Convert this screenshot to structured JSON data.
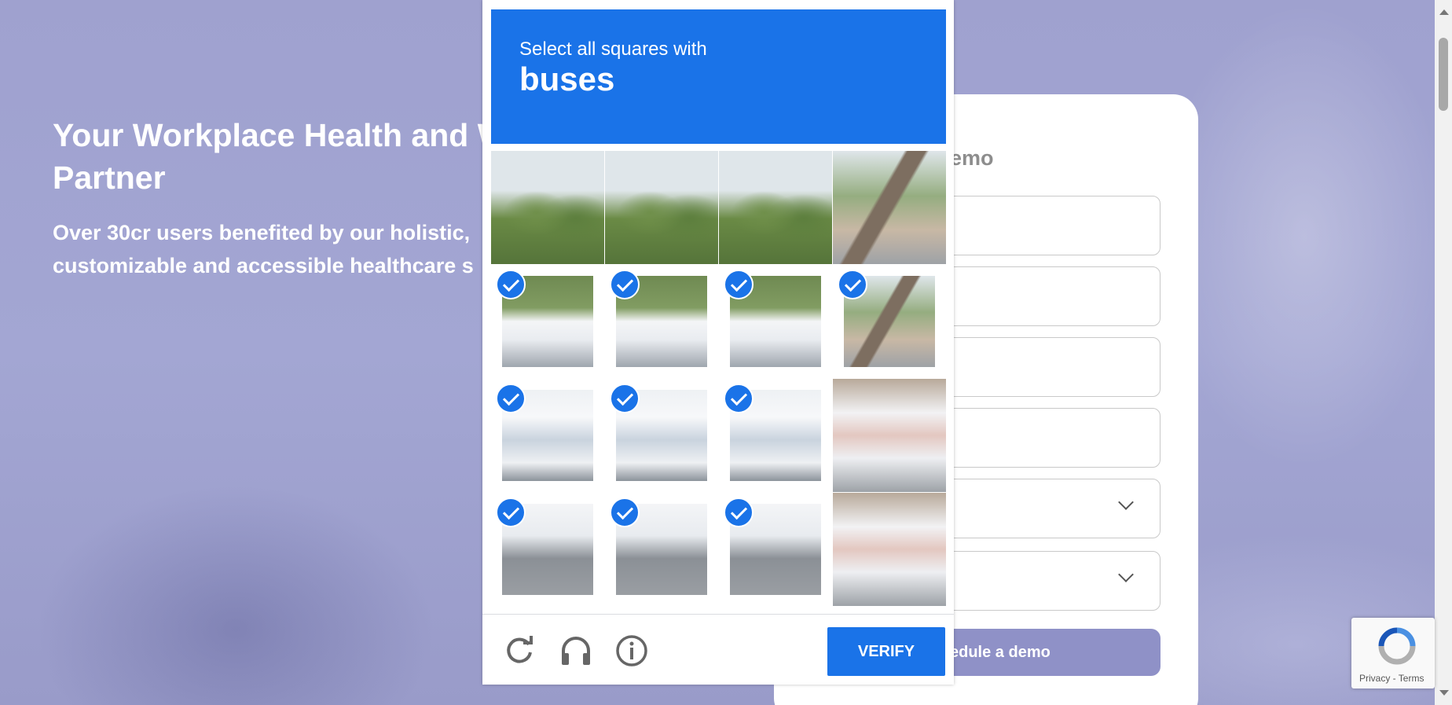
{
  "hero": {
    "title": "Your Workplace Health and W",
    "title_line2": "Partner",
    "subtitle": "Over 30cr users benefited by our holistic,",
    "subtitle_line2": "customizable and accessible healthcare s"
  },
  "form": {
    "title_fragment": "emo",
    "submit_label": "edule a demo"
  },
  "captcha": {
    "prompt": "Select all squares with",
    "target": "buses",
    "accent_color": "#1a73e8",
    "tiles": [
      {
        "row": 1,
        "col": 1,
        "selected": false
      },
      {
        "row": 1,
        "col": 2,
        "selected": false
      },
      {
        "row": 1,
        "col": 3,
        "selected": false
      },
      {
        "row": 1,
        "col": 4,
        "selected": false
      },
      {
        "row": 2,
        "col": 1,
        "selected": true
      },
      {
        "row": 2,
        "col": 2,
        "selected": true
      },
      {
        "row": 2,
        "col": 3,
        "selected": true
      },
      {
        "row": 2,
        "col": 4,
        "selected": true
      },
      {
        "row": 3,
        "col": 1,
        "selected": true
      },
      {
        "row": 3,
        "col": 2,
        "selected": true
      },
      {
        "row": 3,
        "col": 3,
        "selected": true
      },
      {
        "row": 3,
        "col": 4,
        "selected": false
      },
      {
        "row": 4,
        "col": 1,
        "selected": true
      },
      {
        "row": 4,
        "col": 2,
        "selected": true
      },
      {
        "row": 4,
        "col": 3,
        "selected": true
      },
      {
        "row": 4,
        "col": 4,
        "selected": false
      }
    ],
    "icons": [
      "reload-icon",
      "audio-icon",
      "info-icon"
    ],
    "verify_label": "VERIFY"
  },
  "badge": {
    "text": "Privacy - Terms"
  }
}
